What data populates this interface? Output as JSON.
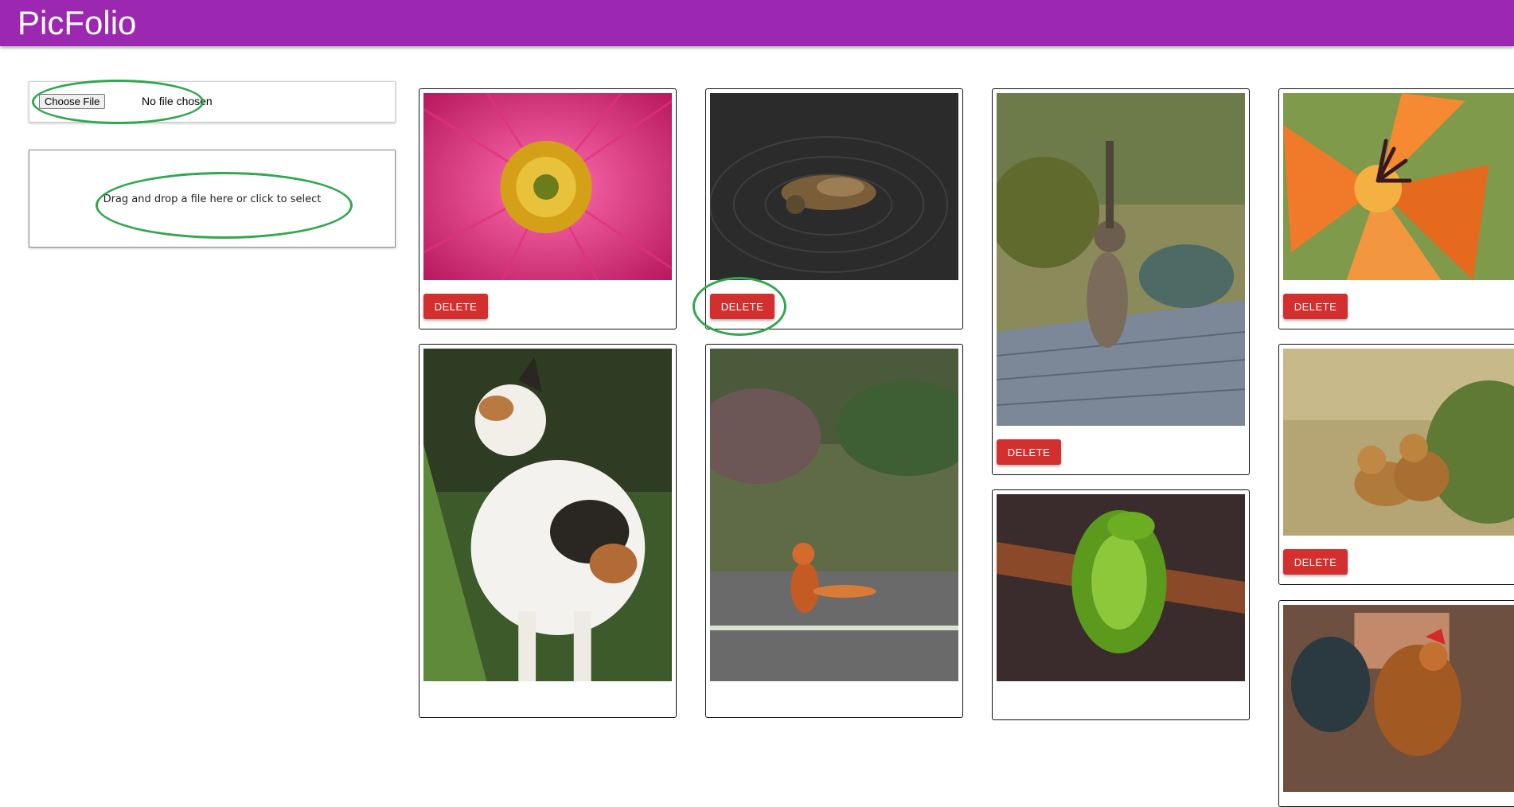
{
  "app": {
    "title": "PicFolio"
  },
  "upload": {
    "choose_file_label": "Choose File",
    "file_status": "No file chosen",
    "dropzone_text": "Drag and drop a file here or click to select"
  },
  "gallery": {
    "delete_label": "DELETE",
    "items": [
      {
        "subject": "pink flower"
      },
      {
        "subject": "duck on water"
      },
      {
        "subject": "tabby cat on deck"
      },
      {
        "subject": "orange lily"
      },
      {
        "subject": "calico cat"
      },
      {
        "subject": "fox on road"
      },
      {
        "subject": "green python on branch"
      },
      {
        "subject": "lion cubs in grass"
      },
      {
        "subject": "rooster"
      }
    ]
  },
  "colors": {
    "appbar": "#9c27b0",
    "delete_button": "#d32f2f",
    "annotation": "#2fa84f"
  }
}
